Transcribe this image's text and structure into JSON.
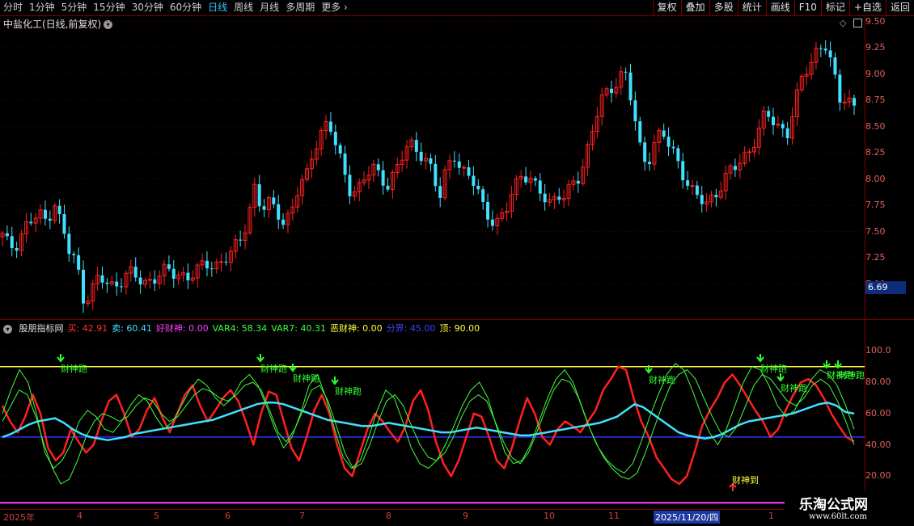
{
  "toolbar": {
    "periods": [
      "分时",
      "1分钟",
      "5分钟",
      "15分钟",
      "30分钟",
      "60分钟",
      "日线",
      "周线",
      "月线",
      "多周期",
      "更多"
    ],
    "active_period": "日线",
    "more_chevron": "›",
    "buttons": [
      "复权",
      "叠加",
      "多股",
      "统计",
      "画线",
      "F10",
      "标记",
      "+自选",
      "返回"
    ]
  },
  "stock": {
    "title": "中盐化工(日线,前复权)"
  },
  "price_axis": {
    "ticks": [
      "9.50",
      "9.25",
      "9.00",
      "8.75",
      "8.50",
      "8.25",
      "8.00",
      "7.75",
      "7.50",
      "7.25",
      "7.00"
    ],
    "current": "6.69"
  },
  "indicator": {
    "name": "股朋指标网",
    "values": [
      {
        "label": "买: 42.91",
        "color": "#ff3030"
      },
      {
        "label": "卖: 60.41",
        "color": "#40e0ff"
      },
      {
        "label": "好财神: 0.00",
        "color": "#ff40ff"
      },
      {
        "label": "VAR4: 58.34",
        "color": "#40ff40"
      },
      {
        "label": "VAR7: 40.31",
        "color": "#40ff40"
      },
      {
        "label": "恶财神: 0.00",
        "color": "#ffff40"
      },
      {
        "label": "分界: 45.00",
        "color": "#4040ff"
      },
      {
        "label": "顶: 90.00",
        "color": "#ffff40"
      }
    ],
    "axis_ticks": [
      "100.0",
      "80.00",
      "60.00",
      "40.00",
      "20.00"
    ],
    "signal_text": "财神跑",
    "signal_text2": "财神到"
  },
  "dates": [
    "2025年",
    "4",
    "5",
    "6",
    "7",
    "8",
    "9",
    "10",
    "11",
    "2025/11/20/四",
    "1"
  ],
  "watermark": {
    "line1": "乐淘公式网",
    "line2": "www.60lt.com"
  },
  "colors": {
    "up": "#ff2020",
    "down": "#40e0ff",
    "bg": "#000000"
  },
  "chart_data": [
    {
      "type": "candlestick",
      "ylim": [
        6.69,
        9.55
      ],
      "ticks": [
        9.5,
        9.25,
        9.0,
        8.75,
        8.5,
        8.25,
        8.0,
        7.75,
        7.5,
        7.25,
        7.0
      ],
      "close_path": [
        7.45,
        7.35,
        7.4,
        7.55,
        7.6,
        7.65,
        7.6,
        7.8,
        7.55,
        7.3,
        7.2,
        6.85,
        6.95,
        7.05,
        7.0,
        6.98,
        7.05,
        7.12,
        7.05,
        7.0,
        7.05,
        7.1,
        7.12,
        7.08,
        7.1,
        7.08,
        7.12,
        7.15,
        7.18,
        7.2,
        7.25,
        7.3,
        7.38,
        7.6,
        7.95,
        7.7,
        7.75,
        7.7,
        7.6,
        7.7,
        7.9,
        8.0,
        8.3,
        8.45,
        8.55,
        8.3,
        8.1,
        7.9,
        7.9,
        8.0,
        8.1,
        8.05,
        7.95,
        8.05,
        8.2,
        8.35,
        8.3,
        8.2,
        8.05,
        7.8,
        8.15,
        8.25,
        8.05,
        8.0,
        7.95,
        7.75,
        7.6,
        7.55,
        7.7,
        7.95,
        8.05,
        8.0,
        7.9,
        7.85,
        7.8,
        7.85,
        7.8,
        7.95,
        8.05,
        8.3,
        8.55,
        8.75,
        8.85,
        8.95,
        9.05,
        8.7,
        8.3,
        8.15,
        8.35,
        8.45,
        8.3,
        8.2,
        8.05,
        7.9,
        7.8,
        7.75,
        7.85,
        7.95,
        8.05,
        8.1,
        8.2,
        8.3,
        8.45,
        8.6,
        8.55,
        8.5,
        8.45,
        8.7,
        8.95,
        9.1,
        9.25,
        9.3,
        9.05,
        8.75,
        8.8,
        8.7
      ]
    },
    {
      "type": "line",
      "ylim": [
        0,
        110
      ],
      "ticks": [
        100,
        80,
        60,
        40,
        20
      ],
      "series": [
        {
          "name": "顶",
          "values": [
            90
          ],
          "color": "#ffff40",
          "constant": true
        },
        {
          "name": "分界",
          "values": [
            45
          ],
          "color": "#3030ff",
          "constant": true
        },
        {
          "name": "买",
          "color": "#ff2020",
          "values": [
            65,
            55,
            48,
            58,
            72,
            60,
            38,
            30,
            35,
            50,
            42,
            35,
            40,
            55,
            68,
            72,
            60,
            45,
            50,
            62,
            70,
            58,
            48,
            60,
            72,
            78,
            65,
            55,
            62,
            70,
            75,
            68,
            55,
            40,
            60,
            74,
            72,
            55,
            38,
            30,
            45,
            62,
            72,
            60,
            40,
            25,
            20,
            35,
            50,
            60,
            55,
            48,
            42,
            52,
            68,
            75,
            62,
            42,
            28,
            20,
            30,
            45,
            60,
            58,
            45,
            30,
            25,
            38,
            55,
            70,
            60,
            45,
            40,
            50,
            55,
            52,
            48,
            55,
            62,
            75,
            82,
            90,
            88,
            70,
            55,
            45,
            32,
            25,
            18,
            15,
            20,
            35,
            52,
            62,
            70,
            80,
            85,
            78,
            70,
            62,
            55,
            45,
            50,
            62,
            72,
            80,
            82,
            78,
            70,
            60,
            52,
            45,
            42
          ]
        },
        {
          "name": "卖",
          "color": "#40e0ff",
          "values": [
            45,
            47,
            50,
            53,
            55,
            56,
            57,
            54,
            50,
            47,
            45,
            44,
            43,
            44,
            45,
            47,
            48,
            49,
            50,
            51,
            52,
            53,
            54,
            55,
            56,
            58,
            60,
            62,
            64,
            66,
            67,
            67,
            66,
            64,
            62,
            60,
            58,
            56,
            55,
            54,
            53,
            52,
            52,
            53,
            54,
            53,
            52,
            51,
            50,
            49,
            48,
            48,
            49,
            50,
            51,
            50,
            49,
            48,
            47,
            46,
            46,
            47,
            48,
            49,
            50,
            51,
            52,
            53,
            54,
            56,
            58,
            62,
            66,
            64,
            60,
            56,
            52,
            48,
            46,
            45,
            44,
            45,
            47,
            50,
            53,
            55,
            56,
            57,
            58,
            59,
            60,
            62,
            64,
            66,
            67,
            65,
            61,
            60
          ]
        },
        {
          "name": "VAR4",
          "color": "#40ff40",
          "values": [
            60,
            75,
            88,
            80,
            60,
            35,
            25,
            30,
            40,
            55,
            62,
            58,
            50,
            48,
            55,
            65,
            72,
            68,
            58,
            50,
            55,
            65,
            75,
            82,
            78,
            70,
            65,
            70,
            80,
            85,
            78,
            65,
            50,
            38,
            45,
            60,
            78,
            85,
            70,
            50,
            32,
            25,
            30,
            45,
            62,
            75,
            70,
            55,
            38,
            28,
            25,
            30,
            40,
            52,
            65,
            75,
            80,
            70,
            52,
            35,
            28,
            30,
            40,
            55,
            70,
            82,
            88,
            80,
            65,
            50,
            38,
            30,
            25,
            22,
            28,
            42,
            58,
            72,
            85,
            92,
            88,
            75,
            60,
            48,
            40,
            50,
            65,
            80,
            90,
            88,
            78,
            65,
            58,
            62,
            72,
            82,
            88,
            85,
            78,
            65,
            50
          ]
        },
        {
          "name": "VAR7",
          "color": "#40ff40",
          "values": [
            55,
            65,
            75,
            72,
            58,
            40,
            25,
            15,
            18,
            30,
            45,
            55,
            60,
            58,
            55,
            58,
            65,
            70,
            68,
            60,
            55,
            58,
            65,
            72,
            76,
            74,
            70,
            68,
            72,
            78,
            80,
            75,
            62,
            48,
            42,
            50,
            62,
            75,
            78,
            68,
            52,
            35,
            25,
            28,
            40,
            55,
            68,
            72,
            65,
            52,
            40,
            32,
            30,
            35,
            45,
            58,
            68,
            72,
            68,
            55,
            42,
            32,
            28,
            35,
            48,
            62,
            75,
            82,
            80,
            70,
            55,
            42,
            32,
            25,
            20,
            18,
            22,
            35,
            50,
            65,
            78,
            85,
            88,
            82,
            70,
            58,
            48,
            45,
            52,
            65,
            78,
            85,
            82,
            75,
            68,
            65,
            70,
            78,
            82,
            78,
            68,
            55,
            40
          ]
        },
        {
          "name": "好财神",
          "color": "#ff40ff",
          "values": [
            0
          ],
          "constant": true
        }
      ]
    }
  ]
}
